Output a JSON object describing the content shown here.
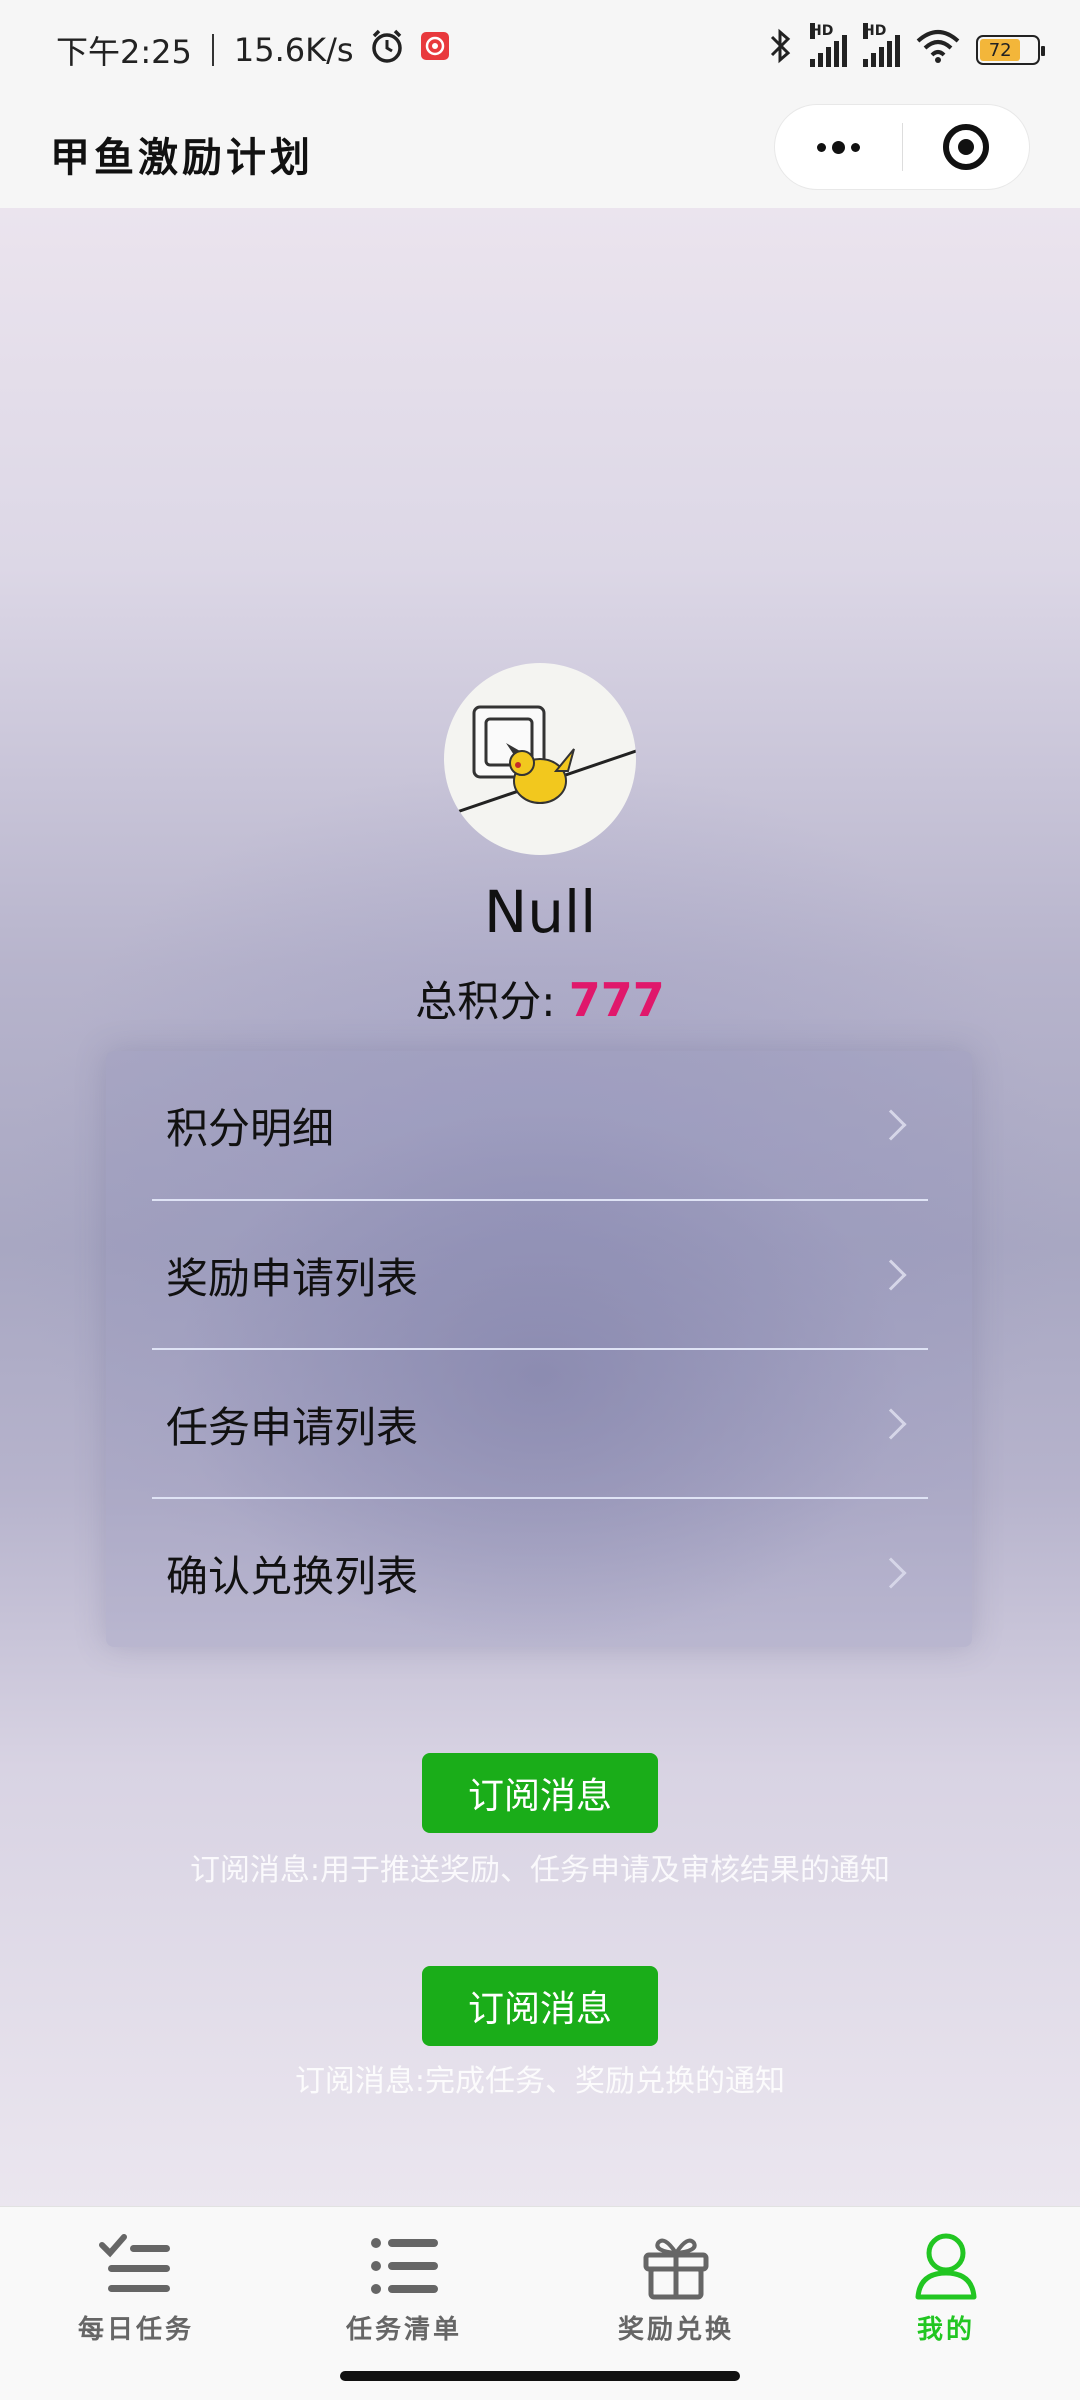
{
  "status_bar": {
    "time": "下午2:25",
    "net_speed": "15.6K/s",
    "battery": "72",
    "icons": [
      "alarm-icon",
      "app-notification-icon",
      "bluetooth-icon",
      "signal-icon",
      "wifi-icon",
      "battery-icon"
    ]
  },
  "header": {
    "title": "甲鱼激励计划",
    "more_icon": "more-dots-icon",
    "close_icon": "target-close-icon"
  },
  "profile": {
    "name": "Null",
    "points_label": "总积分: ",
    "points_value": "777"
  },
  "menu": {
    "items": [
      {
        "label": "积分明细"
      },
      {
        "label": "奖励申请列表"
      },
      {
        "label": "任务申请列表"
      },
      {
        "label": "确认兑换列表"
      }
    ]
  },
  "subscriptions": [
    {
      "button": "订阅消息",
      "desc": "订阅消息:用于推送奖励、任务申请及审核结果的通知"
    },
    {
      "button": "订阅消息",
      "desc": "订阅消息:完成任务、奖励兑换的通知"
    }
  ],
  "tabbar": {
    "tabs": [
      {
        "label": "每日任务",
        "icon": "checklist-icon"
      },
      {
        "label": "任务清单",
        "icon": "list-icon"
      },
      {
        "label": "奖励兑换",
        "icon": "gift-icon"
      },
      {
        "label": "我的",
        "icon": "person-icon"
      }
    ],
    "active_color": "#22c622",
    "inactive_color": "#666666"
  },
  "colors": {
    "points": "#e0186b",
    "subscribe_button": "#1aad19"
  }
}
